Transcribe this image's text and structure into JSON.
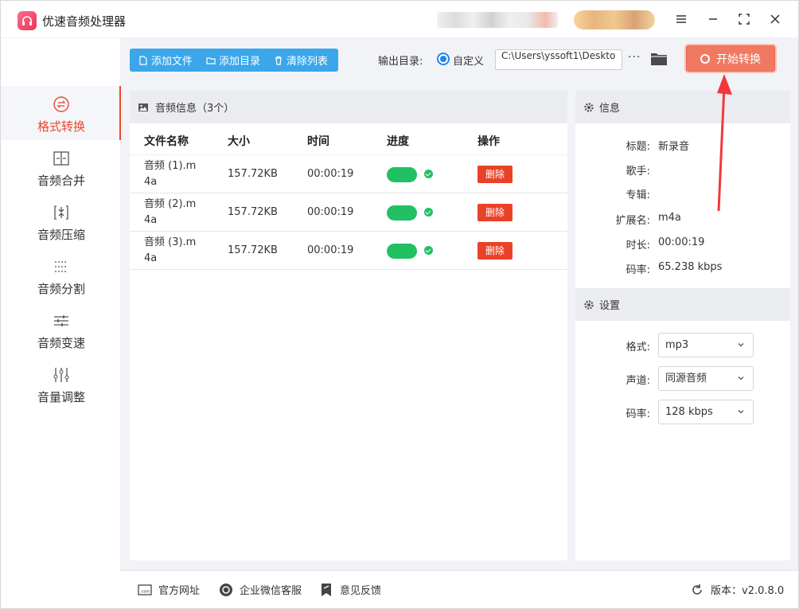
{
  "app": {
    "title": "优速音频处理器"
  },
  "sidebar": {
    "items": [
      {
        "label": "格式转换"
      },
      {
        "label": "音频合并"
      },
      {
        "label": "音频压缩"
      },
      {
        "label": "音频分割"
      },
      {
        "label": "音频变速"
      },
      {
        "label": "音量调整"
      }
    ]
  },
  "toolbar": {
    "add_file": "添加文件",
    "add_dir": "添加目录",
    "clear_list": "清除列表",
    "output_label": "输出目录:",
    "custom_label": "自定义",
    "output_path": "C:\\Users\\yssoft1\\Deskto",
    "more": "···",
    "start": "开始转换"
  },
  "file_panel": {
    "title": "音频信息（3个）",
    "columns": [
      "文件名称",
      "大小",
      "时间",
      "进度",
      "操作"
    ],
    "rows": [
      {
        "name": "音频 (1).m4a",
        "size": "157.72KB",
        "time": "00:00:19",
        "progress": 1.0,
        "action": "删除"
      },
      {
        "name": "音频 (2).m4a",
        "size": "157.72KB",
        "time": "00:00:19",
        "progress": 1.0,
        "action": "删除"
      },
      {
        "name": "音频 (3).m4a",
        "size": "157.72KB",
        "time": "00:00:19",
        "progress": 1.0,
        "action": "删除"
      }
    ]
  },
  "info": {
    "title": "信息",
    "fields": [
      {
        "key": "标题:",
        "value": "新录音"
      },
      {
        "key": "歌手:",
        "value": ""
      },
      {
        "key": "专辑:",
        "value": ""
      },
      {
        "key": "扩展名:",
        "value": "m4a"
      },
      {
        "key": "时长:",
        "value": "00:00:19"
      },
      {
        "key": "码率:",
        "value": "65.238 kbps"
      }
    ]
  },
  "settings": {
    "title": "设置",
    "format_label": "格式:",
    "format_value": "mp3",
    "channel_label": "声道:",
    "channel_value": "同源音频",
    "bitrate_label": "码率:",
    "bitrate_value": "128 kbps"
  },
  "footer": {
    "website": "官方网址",
    "wechat": "企业微信客服",
    "feedback": "意见反馈",
    "version": "版本：v2.0.8.0"
  },
  "colors": {
    "accent": "#e8492f",
    "toolbar_blue": "#3ba7ea",
    "start_button": "#f07a61",
    "progress_green": "#20c063",
    "delete_red": "#e94228"
  }
}
